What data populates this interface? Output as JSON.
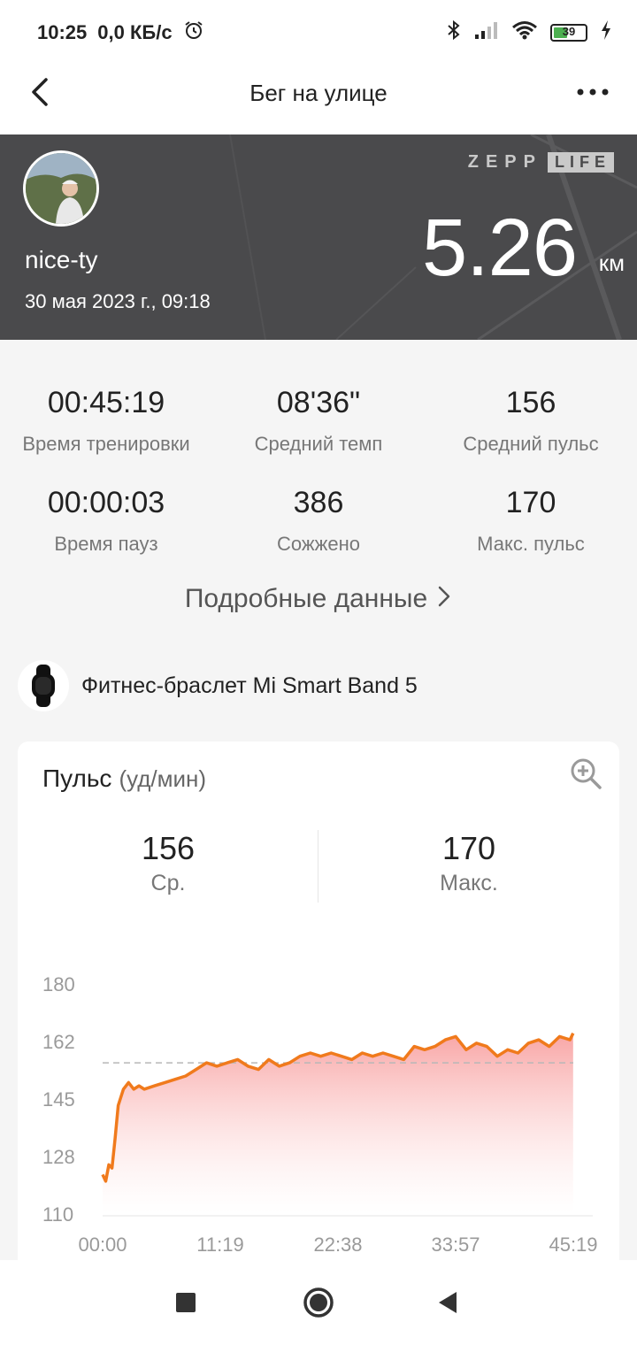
{
  "status_bar": {
    "time": "10:25",
    "speed": "0,0 КБ/с",
    "battery": "39"
  },
  "app_bar": {
    "title": "Бег на улице"
  },
  "hero": {
    "username": "nice-ty",
    "datetime": "30 мая 2023 г., 09:18",
    "brand_zepp": "ZEPP",
    "brand_life": "LIFE",
    "distance": "5.26",
    "distance_unit": "км"
  },
  "stats": [
    {
      "value": "00:45:19",
      "label": "Время тренировки"
    },
    {
      "value": "08'36\"",
      "label": "Средний темп"
    },
    {
      "value": "156",
      "label": "Средний пульс"
    },
    {
      "value": "00:00:03",
      "label": "Время пауз"
    },
    {
      "value": "386",
      "label": "Сожжено"
    },
    {
      "value": "170",
      "label": "Макс. пульс"
    }
  ],
  "details_link": "Подробные данные",
  "device": {
    "name": "Фитнес-браслет Mi Smart Band 5"
  },
  "pulse_card": {
    "title": "Пульс",
    "unit": "(уд/мин)",
    "avg_value": "156",
    "avg_label": "Ср.",
    "max_value": "170",
    "max_label": "Макс."
  },
  "colors": {
    "accent": "#f07a1c",
    "fill_top": "#f8a0a0",
    "hero_bg": "#4a4a4c"
  },
  "chart_data": {
    "type": "area",
    "y_ticks": [
      "180",
      "162",
      "145",
      "128",
      "110"
    ],
    "x_ticks": [
      "00:00",
      "11:19",
      "22:38",
      "33:57",
      "45:19"
    ],
    "ylim": [
      110,
      180
    ],
    "xlim_minutes": [
      0,
      45.32
    ],
    "average": 156,
    "x": [
      0,
      0.3,
      0.6,
      0.9,
      1.2,
      1.5,
      2,
      2.5,
      3,
      3.5,
      4,
      5,
      6,
      7,
      8,
      9,
      10,
      11,
      12,
      13,
      14,
      15,
      16,
      17,
      18,
      19,
      20,
      21,
      22,
      23,
      24,
      25,
      26,
      27,
      28,
      29,
      30,
      31,
      32,
      33,
      34,
      35,
      36,
      37,
      38,
      39,
      40,
      41,
      42,
      43,
      44,
      45,
      45.3
    ],
    "y": [
      122,
      120,
      125,
      124,
      133,
      143,
      148,
      150,
      148,
      149,
      148,
      149,
      150,
      151,
      152,
      154,
      156,
      155,
      156,
      157,
      155,
      154,
      157,
      155,
      156,
      158,
      159,
      158,
      159,
      158,
      157,
      159,
      158,
      159,
      158,
      157,
      161,
      160,
      161,
      163,
      164,
      160,
      162,
      161,
      158,
      160,
      159,
      162,
      163,
      161,
      164,
      163,
      165
    ],
    "series": [
      {
        "name": "",
        "values": []
      }
    ]
  }
}
